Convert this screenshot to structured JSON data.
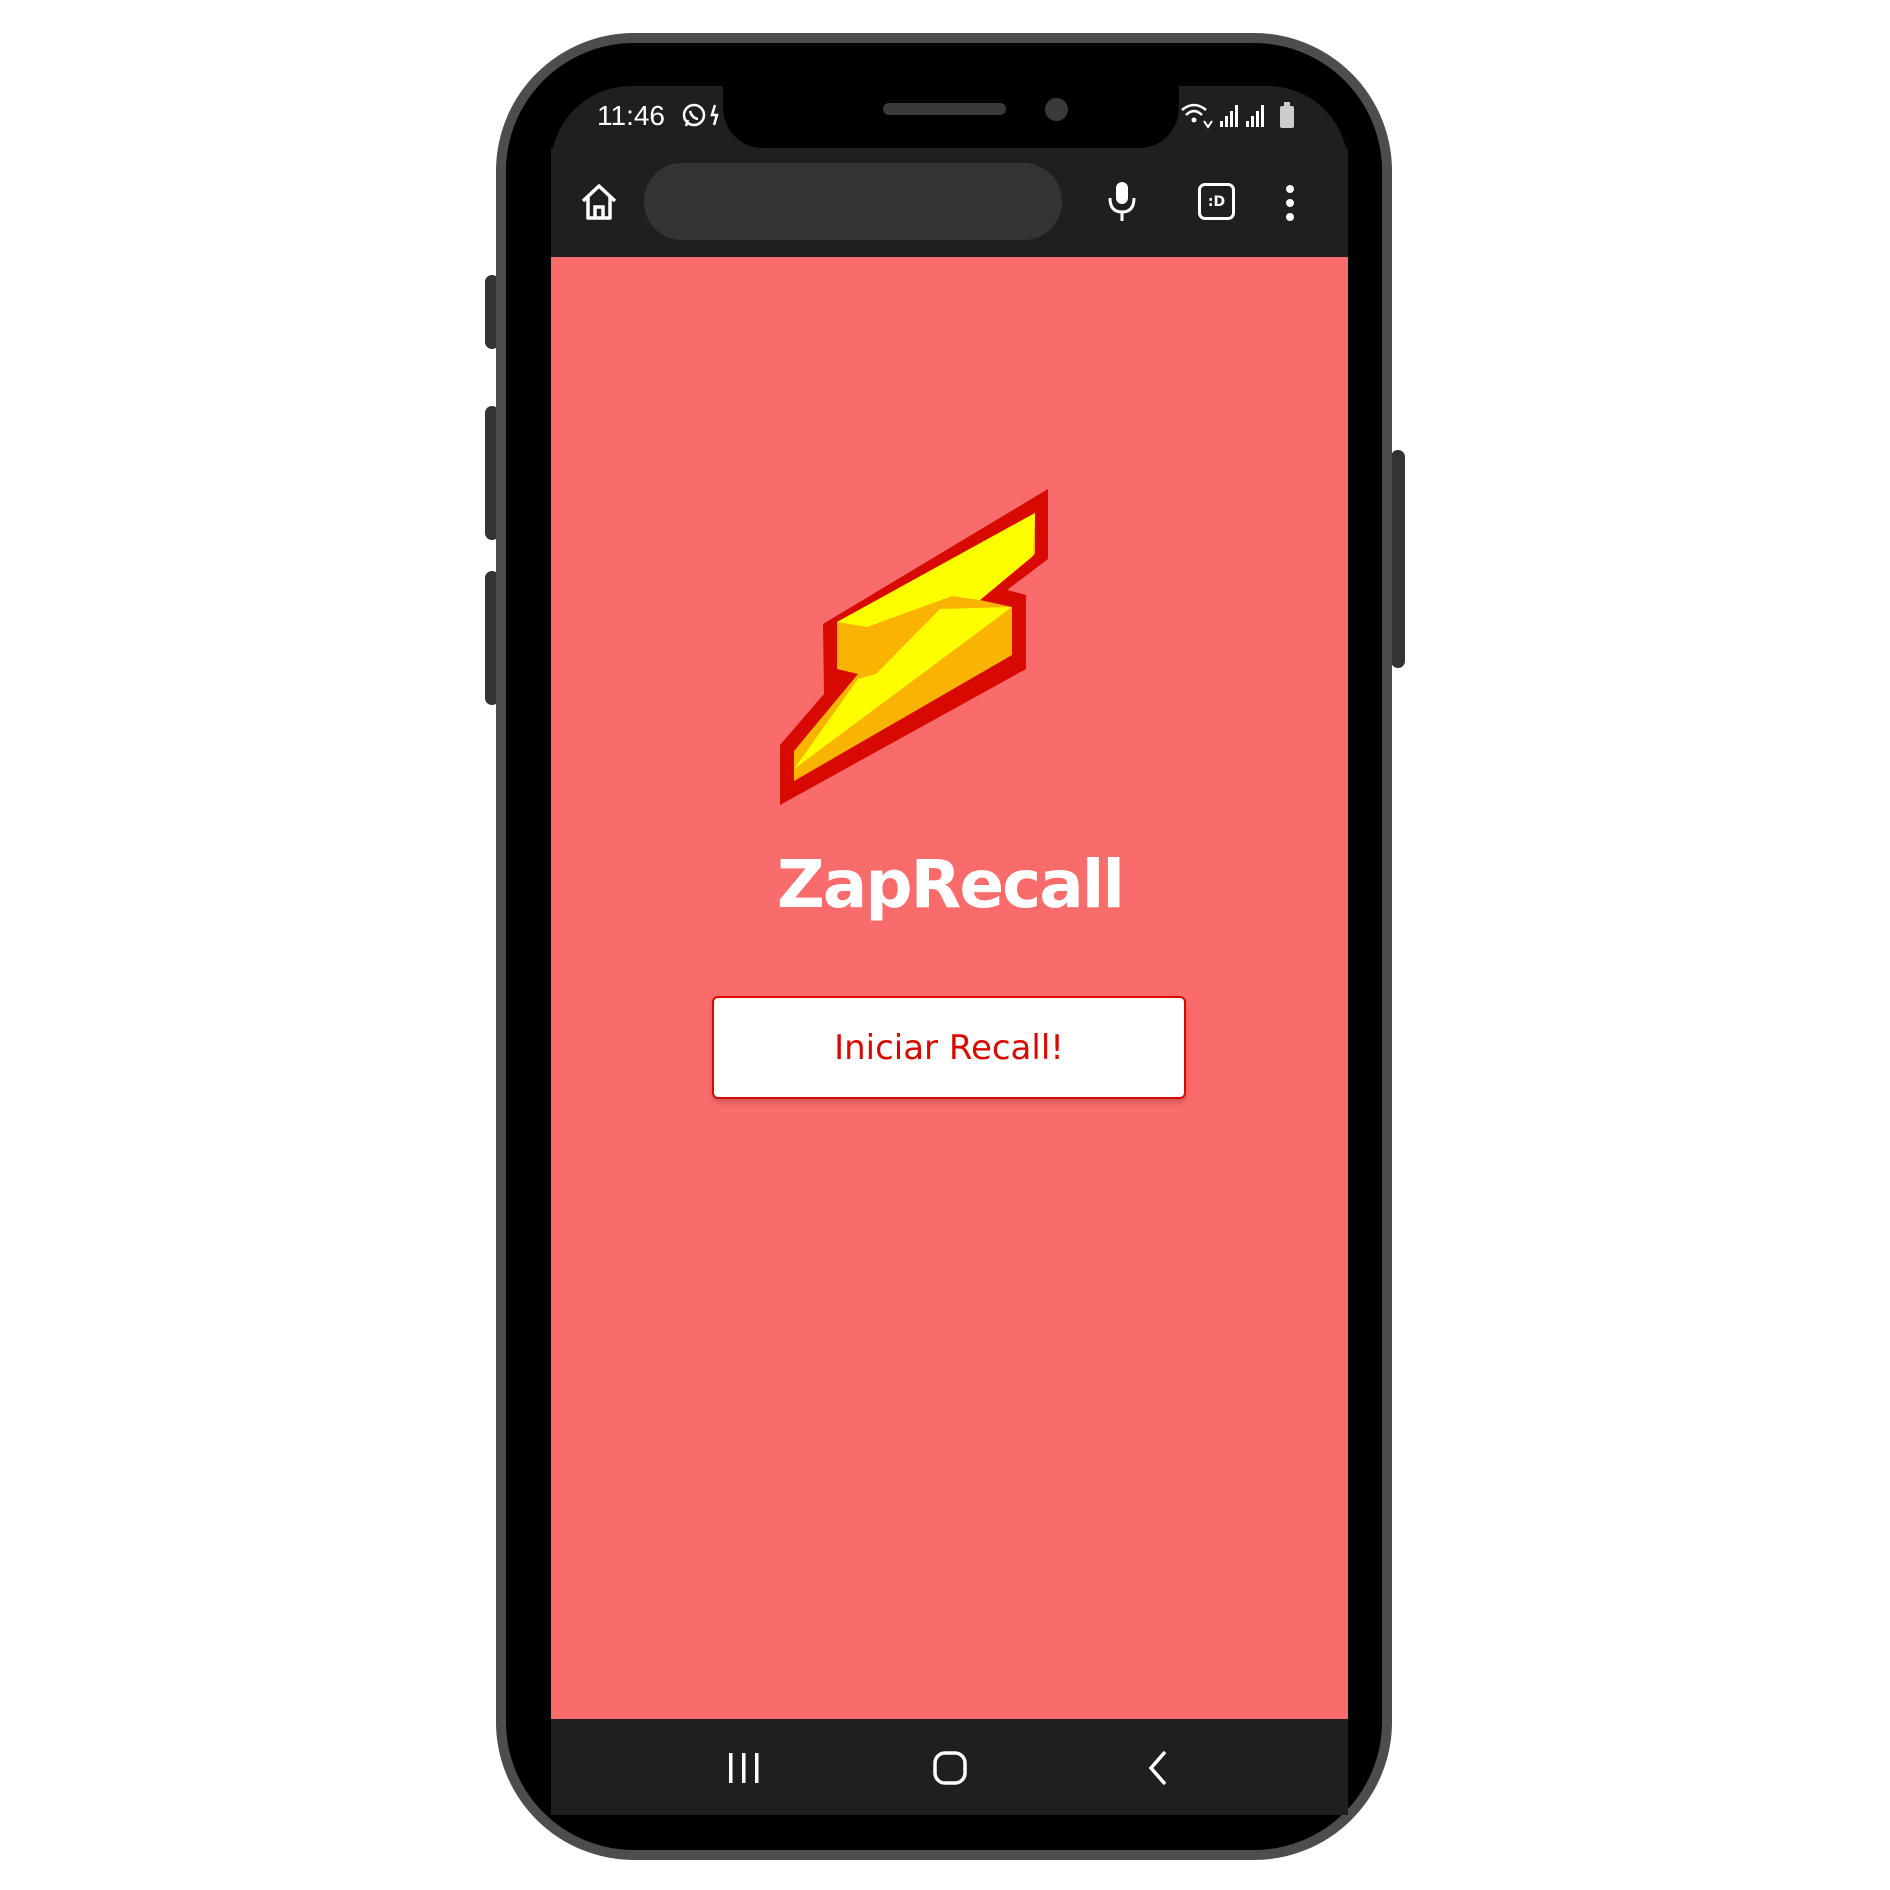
{
  "status_bar": {
    "time": "11:46",
    "left_icons": [
      "whatsapp-icon",
      "notification-icon"
    ],
    "right_icons": [
      "wifi-icon",
      "signal-icon",
      "signal-icon",
      "battery-icon"
    ]
  },
  "browser_toolbar": {
    "url_value": "",
    "tabs_label": ":D",
    "icons": [
      "home-icon",
      "mic-icon",
      "tabs-icon",
      "more-vert-icon"
    ]
  },
  "app": {
    "title": "ZapRecall",
    "start_button_label": "Iniciar Recall!",
    "logo_icon": "lightning-bolt-icon"
  },
  "nav_bar": {
    "icons": [
      "recent-apps-icon",
      "home-circle-icon",
      "back-icon"
    ]
  },
  "colors": {
    "background": "#fa6b6c",
    "accent": "#d70900",
    "title": "#ffffff",
    "bolt_yellow": "#ffff00",
    "bolt_orange": "#f8b400",
    "chrome_dark": "#1f1f1f"
  }
}
